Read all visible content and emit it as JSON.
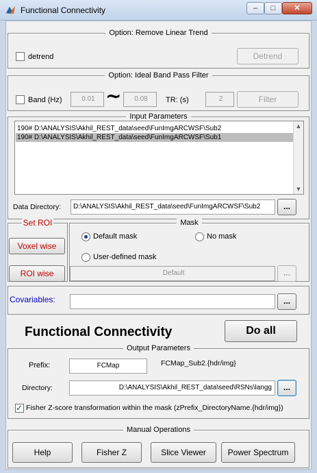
{
  "window": {
    "title": "Functional Connectivity",
    "min": "–",
    "max": "□",
    "close": "✕"
  },
  "detrend": {
    "panel_title": "Option: Remove Linear Trend",
    "checkbox_label": "detrend",
    "button": "Detrend"
  },
  "bandpass": {
    "panel_title": "Option: Ideal Band Pass Filter",
    "checkbox_label": "Band (Hz)",
    "low": "0.01",
    "tilde": "~",
    "high": "0.08",
    "tr_label": "TR: (s)",
    "tr_value": "2",
    "button": "Filter"
  },
  "input": {
    "panel_title": "Input Parameters",
    "list_items": [
      "190# D:\\ANALYSIS\\Akhil_REST_data\\seed\\FunImgARCWSF\\Sub2",
      "190# D:\\ANALYSIS\\Akhil_REST_data\\seed\\FunImgARCWSF\\Sub1"
    ],
    "selected_index": 1,
    "data_dir_label": "Data Directory:",
    "data_dir_value": "D:\\ANALYSIS\\Akhil_REST_data\\seed\\FunImgARCWSF\\Sub2",
    "browse": "..."
  },
  "roi": {
    "panel_title": "Set ROI",
    "voxel_button": "Voxel wise",
    "roi_button": "ROI wise"
  },
  "mask": {
    "panel_title": "Mask",
    "default_label": "Default mask",
    "none_label": "No mask",
    "user_label": "User-defined mask",
    "selected": "default",
    "field_value": "Default",
    "browse": "..."
  },
  "covariables": {
    "label": "Covariables:",
    "value": "",
    "browse": "..."
  },
  "main": {
    "heading": "Functional Connectivity",
    "do_all": "Do all"
  },
  "output": {
    "panel_title": "Output Parameters",
    "prefix_label": "Prefix:",
    "prefix_value": "FCMap",
    "prefix_preview": "FCMap_Sub2.{hdr/img}",
    "dir_label": "Directory:",
    "dir_value": "D:\\ANALYSIS\\Akhil_REST_data\\seed\\RSNs\\langg",
    "browse": "...",
    "fisher_label": "Fisher Z-score transformation within the mask (zPrefix_DirectoryName.{hdr/img})",
    "fisher_checked": true
  },
  "manual": {
    "panel_title": "Manual Operations",
    "help": "Help",
    "fisher": "Fisher Z",
    "slice": "Slice Viewer",
    "power": "Power Spectrum"
  },
  "colors": {
    "roi_red": "#c00000",
    "cov_blue": "#0000c0",
    "selection": "#bcbcbc"
  }
}
